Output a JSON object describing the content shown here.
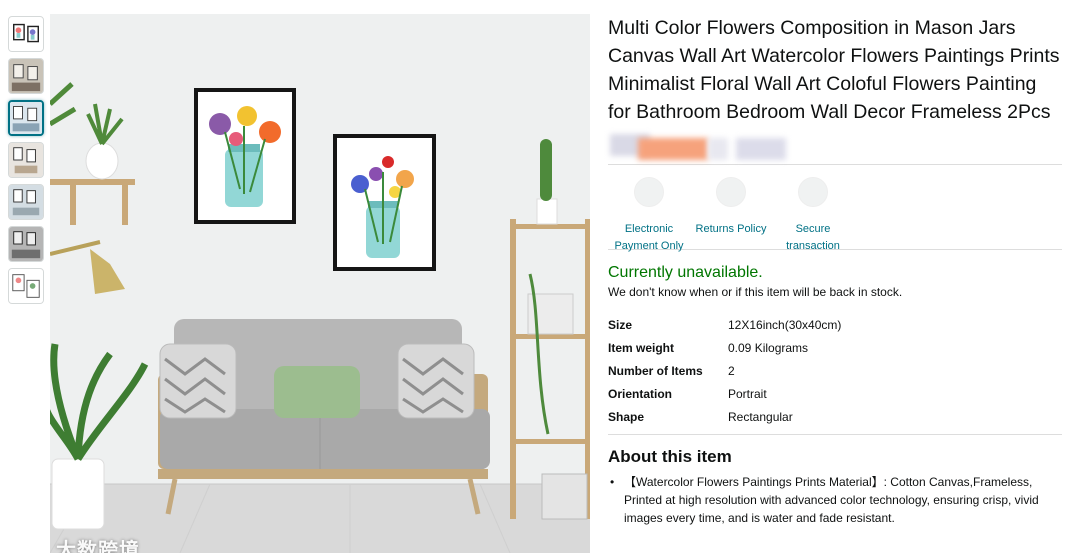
{
  "product": {
    "title": "Multi Color Flowers Composition in Mason Jars Canvas Wall Art Watercolor Flowers Paintings Prints Minimalist Floral Wall Art Coloful Flowers Painting for Bathroom Bedroom Wall Decor Frameless 2Pcs"
  },
  "thumbnails": [
    {
      "label": "thumbnail-1"
    },
    {
      "label": "thumbnail-2"
    },
    {
      "label": "thumbnail-3"
    },
    {
      "label": "thumbnail-4"
    },
    {
      "label": "thumbnail-5"
    },
    {
      "label": "thumbnail-6"
    },
    {
      "label": "thumbnail-7"
    }
  ],
  "trust": [
    {
      "label": "Electronic Payment Only",
      "icon": "payment-icon"
    },
    {
      "label": "Returns Policy",
      "icon": "returns-icon"
    },
    {
      "label": "Secure transaction",
      "icon": "secure-icon"
    }
  ],
  "availability": {
    "status": "Currently unavailable.",
    "note": "We don't know when or if this item will be back in stock."
  },
  "specs": [
    {
      "key": "Size",
      "value": "12X16inch(30x40cm)"
    },
    {
      "key": "Item weight",
      "value": "0.09 Kilograms"
    },
    {
      "key": "Number of Items",
      "value": "2"
    },
    {
      "key": "Orientation",
      "value": "Portrait"
    },
    {
      "key": "Shape",
      "value": "Rectangular"
    }
  ],
  "about": {
    "heading": "About this item",
    "bullets": [
      "【Watercolor Flowers Paintings Prints Material】: Cotton Canvas,Frameless, Printed at high resolution with advanced color technology, ensuring crisp, vivid images every time, and is water and fade resistant."
    ]
  },
  "watermark": "大数跨境",
  "colors": {
    "link": "#007185",
    "available": "#007600",
    "text": "#0f1111",
    "blurred_price": "#f5a07a"
  }
}
